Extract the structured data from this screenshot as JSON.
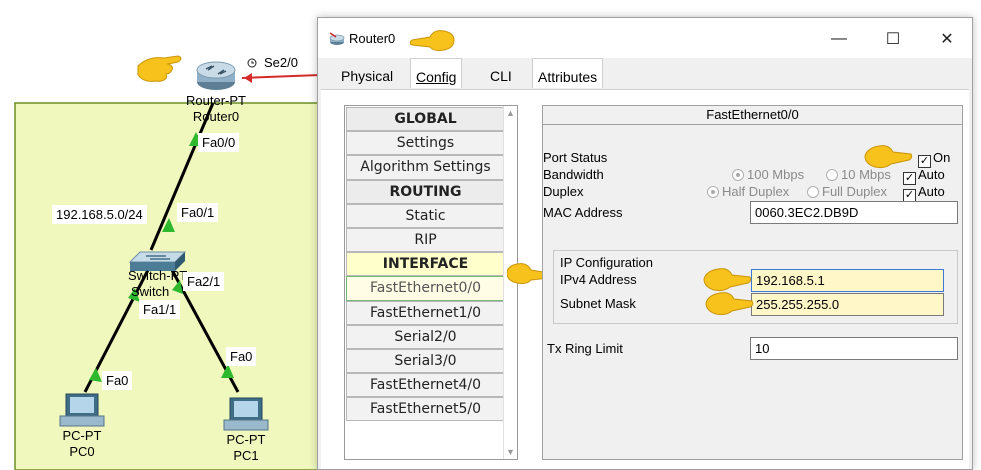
{
  "topology": {
    "router": {
      "type_label": "Router-PT",
      "name_label": "Router0"
    },
    "switch": {
      "type_label": "Switch-PT",
      "name_label": "Switch"
    },
    "pc0": {
      "type_label": "PC-PT",
      "name_label": "PC0"
    },
    "pc1": {
      "type_label": "PC-PT",
      "name_label": "PC1"
    },
    "ports": {
      "router_se": "Se2/0",
      "router_fa": "Fa0/0",
      "switch_fa01": "Fa0/1",
      "switch_fa21": "Fa2/1",
      "switch_fa11": "Fa1/1",
      "pc0_fa": "Fa0",
      "pc1_fa": "Fa0"
    },
    "network_label": "192.168.5.0/24",
    "colors": {
      "area": "#f0f8be",
      "area_border": "#6b8e23",
      "link": "#000000",
      "link_up": "#2db82d",
      "serial": "#d42a2a"
    }
  },
  "window": {
    "title": "Router0",
    "minimize": "—",
    "maximize": "☐",
    "close": "✕"
  },
  "tabs": {
    "physical": "Physical",
    "config": "Config",
    "cli": "CLI",
    "attributes": "Attributes"
  },
  "nav": {
    "items": [
      {
        "label": "GLOBAL",
        "kind": "header"
      },
      {
        "label": "Settings",
        "kind": "item"
      },
      {
        "label": "Algorithm Settings",
        "kind": "item"
      },
      {
        "label": "ROUTING",
        "kind": "header"
      },
      {
        "label": "Static",
        "kind": "item"
      },
      {
        "label": "RIP",
        "kind": "item"
      },
      {
        "label": "INTERFACE",
        "kind": "header-highlight"
      },
      {
        "label": "FastEthernet0/0",
        "kind": "selected"
      },
      {
        "label": "FastEthernet1/0",
        "kind": "item"
      },
      {
        "label": "Serial2/0",
        "kind": "item"
      },
      {
        "label": "Serial3/0",
        "kind": "item"
      },
      {
        "label": "FastEthernet4/0",
        "kind": "item"
      },
      {
        "label": "FastEthernet5/0",
        "kind": "item"
      }
    ]
  },
  "panel": {
    "title": "FastEthernet0/0",
    "port_status_label": "Port Status",
    "port_status_on": "On",
    "bandwidth_label": "Bandwidth",
    "bw_100": "100 Mbps",
    "bw_10": "10 Mbps",
    "bw_auto": "Auto",
    "duplex_label": "Duplex",
    "dup_half": "Half Duplex",
    "dup_full": "Full Duplex",
    "dup_auto": "Auto",
    "mac_label": "MAC Address",
    "mac_value": "0060.3EC2.DB9D",
    "ip_config_label": "IP Configuration",
    "ipv4_label": "IPv4 Address",
    "ipv4_value": "192.168.5.1",
    "subnet_label": "Subnet Mask",
    "subnet_value": "255.255.255.0",
    "tx_label": "Tx Ring Limit",
    "tx_value": "10"
  },
  "colors": {
    "highlight": "#fff7c8",
    "hand": "#f7c21b"
  }
}
